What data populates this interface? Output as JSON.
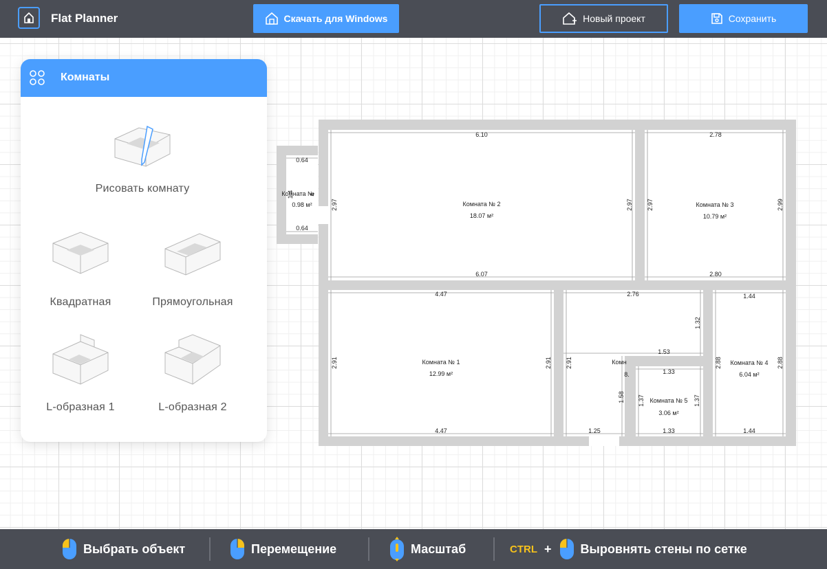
{
  "app": {
    "title": "Flat Planner"
  },
  "toolbar": {
    "download_label": "Скачать для Windows",
    "new_project_label": "Новый проект",
    "save_label": "Сохранить"
  },
  "panel": {
    "title": "Комнаты",
    "tools": [
      {
        "label": "Рисовать комнату",
        "icon": "draw-room-icon"
      },
      {
        "label": "Квадратная",
        "icon": "square-room-icon"
      },
      {
        "label": "Прямоугольная",
        "icon": "rect-room-icon"
      },
      {
        "label": "L-образная 1",
        "icon": "l-room-1-icon"
      },
      {
        "label": "L-образная 2",
        "icon": "l-room-2-icon"
      }
    ]
  },
  "plan": {
    "rooms": [
      {
        "name": "Комната № 1",
        "area": "12.99 м²"
      },
      {
        "name": "Комната № 2",
        "area": "18.07 м²"
      },
      {
        "name": "Комната № 3",
        "area": "10.79 м²"
      },
      {
        "name": "Комната № 4",
        "area": "6.04 м²"
      },
      {
        "name": "Комната № 5",
        "area": "3.06 м²"
      },
      {
        "name": "Комната №",
        "area": "0.98 м²"
      },
      {
        "name": "Комн",
        "area": "8."
      }
    ],
    "dims": {
      "r2_top": "6.10",
      "r2_bottom": "6.07",
      "r2_left": "2.97",
      "r2_right": "2.97",
      "r3_top": "2.78",
      "r3_bottom": "2.80",
      "r3_left": "2.97",
      "r3_right": "2.99",
      "r6_top": "0.64",
      "r6_bottom": "0.64",
      "r6_side_a": "1.4",
      "r6_side_b": "4",
      "r1_top": "4.47",
      "r1_bottom": "4.47",
      "r1_left": "2.91",
      "r1_right": "2.91",
      "r7_top": "2.76",
      "r7_left": "2.91",
      "r7_side": "1.32",
      "r7_step": "1.53",
      "r7_lower": "1.58",
      "r7_bottom": "1.25",
      "r5_top": "1.33",
      "r5_bottom": "1.33",
      "r5_left": "1.37",
      "r5_right": "1.37",
      "r4_top": "1.44",
      "r4_bottom": "1.44",
      "r4_left": "2.88",
      "r4_right": "2.88"
    }
  },
  "hints": {
    "select": "Выбрать объект",
    "move": "Перемещение",
    "zoom": "Масштаб",
    "ctrl": "CTRL",
    "plus": "+",
    "align": "Выровнять стены по сетке"
  },
  "colors": {
    "accent": "#4a9eff",
    "bar": "#4a4d55",
    "wall": "#d2d2d2",
    "ctrl": "#f7c21b"
  }
}
